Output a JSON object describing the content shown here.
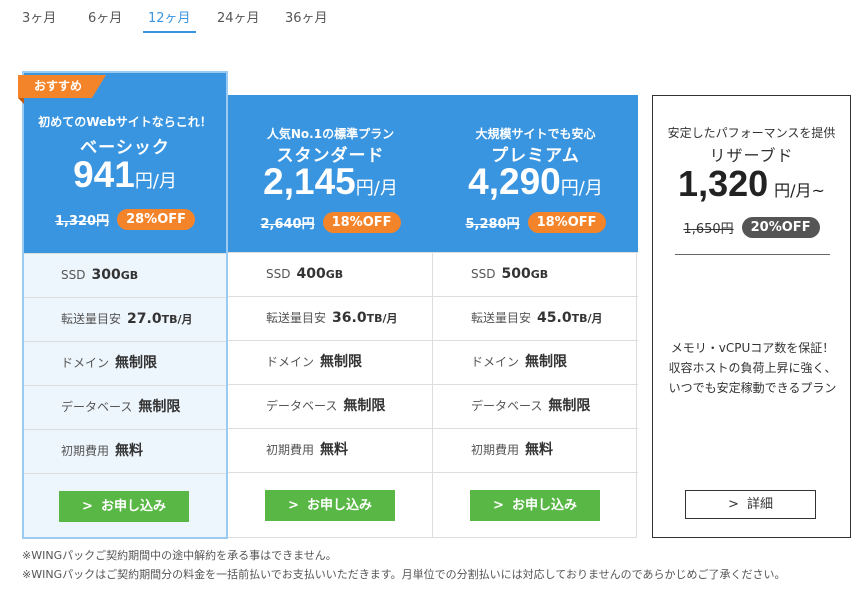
{
  "tabs": [
    "3ヶ月",
    "6ヶ月",
    "12ヶ月",
    "24ヶ月",
    "36ヶ月"
  ],
  "active_tab": "12ヶ月",
  "colors": {
    "accent": "#3a95e0",
    "orange": "#f4842a",
    "green": "#59b845",
    "featured_bg": "#eef6fd"
  },
  "icons": {
    "chevron": "chevron-right-icon"
  },
  "plans": [
    {
      "badge": "おすすめ",
      "tagline": "初めてのWebサイトならこれ！",
      "name": "ベーシック",
      "price": "941",
      "unit": "円/月",
      "old_price": "1,320円",
      "discount": "28%OFF",
      "specs": [
        {
          "label": "SSD",
          "value": "300",
          "unit": "GB"
        },
        {
          "label": "転送量目安",
          "value": "27.0",
          "unit": "TB/月"
        },
        {
          "label": "ドメイン",
          "value": "無制限",
          "unit": ""
        },
        {
          "label": "データベース",
          "value": "無制限",
          "unit": ""
        },
        {
          "label": "初期費用",
          "value": "無料",
          "unit": ""
        }
      ],
      "button": "お申し込み"
    },
    {
      "tagline": "人気No.1の標準プラン",
      "name": "スタンダード",
      "price": "2,145",
      "unit": "円/月",
      "old_price": "2,640円",
      "discount": "18%OFF",
      "specs": [
        {
          "label": "SSD",
          "value": "400",
          "unit": "GB"
        },
        {
          "label": "転送量目安",
          "value": "36.0",
          "unit": "TB/月"
        },
        {
          "label": "ドメイン",
          "value": "無制限",
          "unit": ""
        },
        {
          "label": "データベース",
          "value": "無制限",
          "unit": ""
        },
        {
          "label": "初期費用",
          "value": "無料",
          "unit": ""
        }
      ],
      "button": "お申し込み"
    },
    {
      "tagline": "大規模サイトでも安心",
      "name": "プレミアム",
      "price": "4,290",
      "unit": "円/月",
      "old_price": "5,280円",
      "discount": "18%OFF",
      "specs": [
        {
          "label": "SSD",
          "value": "500",
          "unit": "GB"
        },
        {
          "label": "転送量目安",
          "value": "45.0",
          "unit": "TB/月"
        },
        {
          "label": "ドメイン",
          "value": "無制限",
          "unit": ""
        },
        {
          "label": "データベース",
          "value": "無制限",
          "unit": ""
        },
        {
          "label": "初期費用",
          "value": "無料",
          "unit": ""
        }
      ],
      "button": "お申し込み"
    }
  ],
  "reserved": {
    "tagline": "安定したパフォーマンスを提供",
    "name": "リザーブド",
    "price": "1,320",
    "unit": "円/月~",
    "old_price": "1,650円",
    "discount": "20%OFF",
    "description": "メモリ・vCPUコア数を保証！収容ホストの負荷上昇に強く、いつでも安定稼動できるプラン",
    "button": "詳細"
  },
  "notes": [
    "※WINGパックご契約期間中の途中解約を承る事はできません。",
    "※WINGパックはご契約期間分の料金を一括前払いでお支払いいただきます。月単位での分割払いには対応しておりませんのであらかじめご了承ください。"
  ]
}
